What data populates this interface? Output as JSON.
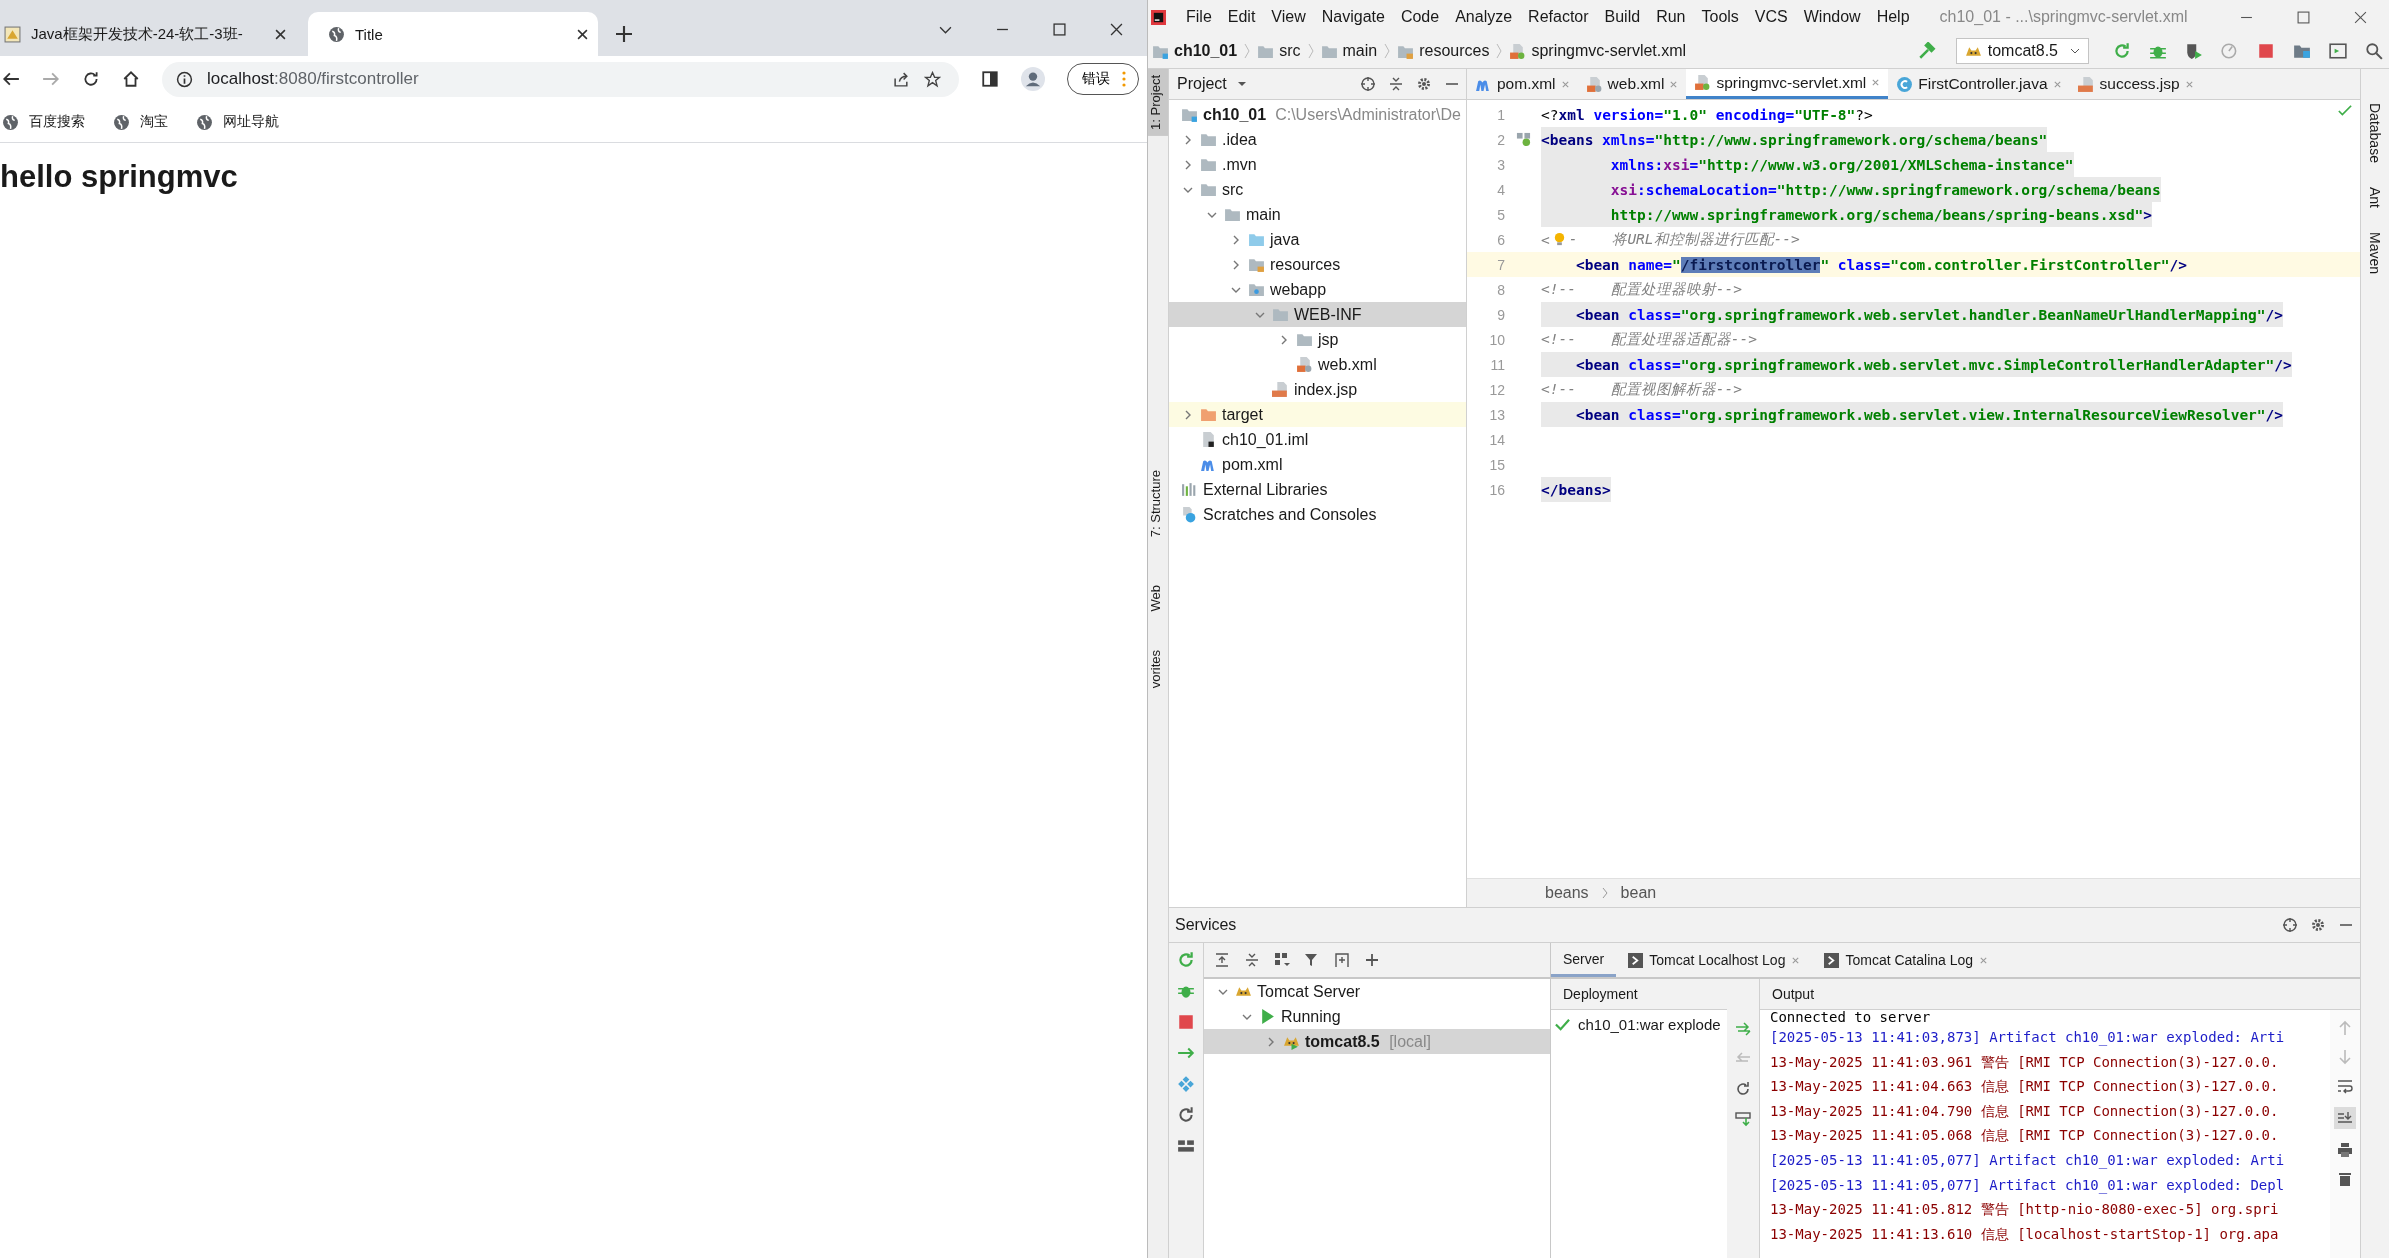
{
  "browser": {
    "tabs": [
      {
        "title": "Java框架开发技术-24-软工-3班-",
        "kind": "site",
        "selected": false
      },
      {
        "title": "Title",
        "kind": "globe",
        "selected": true
      }
    ],
    "address": {
      "host": "localhost",
      "rest": ":8080/firstcontroller"
    },
    "profile_button": "错误",
    "bookmarks": [
      "百度搜索",
      "淘宝",
      "网址导航"
    ],
    "heading": "hello springmvc"
  },
  "ide": {
    "menu": [
      "File",
      "Edit",
      "View",
      "Navigate",
      "Code",
      "Analyze",
      "Refactor",
      "Build",
      "Run",
      "Tools",
      "VCS",
      "Window",
      "Help"
    ],
    "window_title": "ch10_01 - ...\\springmvc-servlet.xml",
    "breadcrumb": [
      {
        "label": "ch10_01",
        "kind": "module"
      },
      {
        "label": "src",
        "kind": "folder"
      },
      {
        "label": "main",
        "kind": "folder"
      },
      {
        "label": "resources",
        "kind": "resources"
      },
      {
        "label": "springmvc-servlet.xml",
        "kind": "spring"
      }
    ],
    "run_config": "tomcat8.5",
    "left_stripe": [
      {
        "label": "1: Project",
        "selected": true
      },
      {
        "label": "7: Structure",
        "selected": false
      },
      {
        "label": "Web",
        "selected": false
      },
      {
        "label": "vorites",
        "selected": false
      }
    ],
    "right_stripe": [
      "Database",
      "Ant",
      "Maven"
    ],
    "project": {
      "title": "Project",
      "root": {
        "name": "ch10_01",
        "path": "C:\\Users\\Administrator\\De",
        "selected": false,
        "children": [
          {
            "name": ".idea",
            "kind": "folder",
            "expanded": false,
            "selected": false
          },
          {
            "name": ".mvn",
            "kind": "folder",
            "expanded": false,
            "selected": false
          },
          {
            "name": "src",
            "kind": "folder",
            "expanded": true,
            "selected": false,
            "children": [
              {
                "name": "main",
                "kind": "folder",
                "expanded": true,
                "selected": false,
                "children": [
                  {
                    "name": "java",
                    "kind": "source",
                    "expanded": false,
                    "selected": false
                  },
                  {
                    "name": "resources",
                    "kind": "resources",
                    "expanded": false,
                    "selected": false
                  },
                  {
                    "name": "webapp",
                    "kind": "web",
                    "expanded": true,
                    "selected": false,
                    "children": [
                      {
                        "name": "WEB-INF",
                        "kind": "folder",
                        "expanded": true,
                        "selected": true,
                        "children": [
                          {
                            "name": "jsp",
                            "kind": "folder",
                            "expanded": false,
                            "selected": false
                          },
                          {
                            "name": "web.xml",
                            "kind": "xml",
                            "selected": false
                          }
                        ]
                      },
                      {
                        "name": "index.jsp",
                        "kind": "jsp",
                        "selected": false
                      }
                    ]
                  }
                ]
              }
            ]
          },
          {
            "name": "target",
            "kind": "excluded",
            "expanded": false,
            "selected": false
          },
          {
            "name": "ch10_01.iml",
            "kind": "iml",
            "selected": false
          },
          {
            "name": "pom.xml",
            "kind": "maven",
            "selected": false
          }
        ]
      },
      "extra": [
        {
          "name": "External Libraries",
          "kind": "libraries",
          "selected": false
        },
        {
          "name": "Scratches and Consoles",
          "kind": "scratches",
          "selected": false
        }
      ]
    },
    "editor_tabs": [
      {
        "label": "pom.xml",
        "kind": "maven",
        "selected": false
      },
      {
        "label": "web.xml",
        "kind": "xml",
        "selected": false
      },
      {
        "label": "springmvc-servlet.xml",
        "kind": "spring",
        "selected": true
      },
      {
        "label": "FirstController.java",
        "kind": "class",
        "selected": false
      },
      {
        "label": "success.jsp",
        "kind": "jsp",
        "selected": false
      }
    ],
    "code_lines": [
      {
        "number": "1",
        "shaded": false,
        "current": false,
        "gutter_icon": false,
        "tokens": [
          {
            "t": "<?",
            "kind": "punct"
          },
          {
            "t": "xml",
            "kind": "tag"
          },
          {
            "t": " version=",
            "kind": "attr"
          },
          {
            "t": "\"1.0\"",
            "kind": "value"
          },
          {
            "t": " encoding=",
            "kind": "attr"
          },
          {
            "t": "\"UTF-8\"",
            "kind": "value"
          },
          {
            "t": "?>",
            "kind": "punct"
          }
        ]
      },
      {
        "number": "2",
        "shaded": true,
        "current": false,
        "gutter_icon": true,
        "tokens": [
          {
            "t": "<beans",
            "kind": "tag"
          },
          {
            "t": " xmlns=",
            "kind": "attr"
          },
          {
            "t": "\"http://www.springframework.org/schema/beans\"",
            "kind": "value"
          }
        ]
      },
      {
        "number": "3",
        "shaded": true,
        "current": false,
        "gutter_icon": false,
        "tokens": [
          {
            "t": "        xmlns:",
            "kind": "attr"
          },
          {
            "t": "xsi",
            "kind": "ns"
          },
          {
            "t": "=",
            "kind": "attr"
          },
          {
            "t": "\"http://www.w3.org/2001/XMLSchema-instance\"",
            "kind": "value"
          }
        ]
      },
      {
        "number": "4",
        "shaded": true,
        "current": false,
        "gutter_icon": false,
        "tokens": [
          {
            "t": "        xsi",
            "kind": "ns"
          },
          {
            "t": ":schemaLocation=",
            "kind": "attr"
          },
          {
            "t": "\"http://www.springframework.org/schema/beans",
            "kind": "value"
          }
        ]
      },
      {
        "number": "5",
        "shaded": true,
        "current": false,
        "gutter_icon": false,
        "tokens": [
          {
            "t": "        http://www.springframework.org/schema/beans/spring-beans.xsd\"",
            "kind": "value"
          },
          {
            "t": ">",
            "kind": "tag"
          }
        ]
      },
      {
        "number": "6",
        "shaded": false,
        "current": false,
        "gutter_icon": false,
        "tokens": [
          {
            "t": "<",
            "kind": "comment"
          },
          {
            "kind": "bulb"
          },
          {
            "t": "-    将URL和控制器进行匹配-->",
            "kind": "comment"
          }
        ]
      },
      {
        "number": "7",
        "shaded": false,
        "current": true,
        "gutter_icon": false,
        "tokens": [
          {
            "t": "    <bean",
            "kind": "tag"
          },
          {
            "t": " name=",
            "kind": "attr"
          },
          {
            "t": "\"",
            "kind": "value"
          },
          {
            "t": "/firstcontroller",
            "kind": "selection"
          },
          {
            "t": "\"",
            "kind": "value"
          },
          {
            "t": " class=",
            "kind": "attr"
          },
          {
            "t": "\"com.controller.FirstController\"",
            "kind": "value"
          },
          {
            "t": "/>",
            "kind": "tag"
          }
        ]
      },
      {
        "number": "8",
        "shaded": false,
        "current": false,
        "gutter_icon": false,
        "tokens": [
          {
            "t": "<!--    配置处理器映射-->",
            "kind": "comment"
          }
        ]
      },
      {
        "number": "9",
        "shaded": true,
        "current": false,
        "gutter_icon": false,
        "tokens": [
          {
            "t": "    <bean",
            "kind": "tag"
          },
          {
            "t": " class=",
            "kind": "attr"
          },
          {
            "t": "\"org.springframework.web.servlet.handler.BeanNameUrlHandlerMapping\"",
            "kind": "value"
          },
          {
            "t": "/>",
            "kind": "tag"
          }
        ]
      },
      {
        "number": "10",
        "shaded": false,
        "current": false,
        "gutter_icon": false,
        "tokens": [
          {
            "t": "<!--    配置处理器适配器-->",
            "kind": "comment"
          }
        ]
      },
      {
        "number": "11",
        "shaded": true,
        "current": false,
        "gutter_icon": false,
        "tokens": [
          {
            "t": "    <bean",
            "kind": "tag"
          },
          {
            "t": " class=",
            "kind": "attr"
          },
          {
            "t": "\"org.springframework.web.servlet.mvc.SimpleControllerHandlerAdapter\"",
            "kind": "value"
          },
          {
            "t": "/>",
            "kind": "tag"
          }
        ]
      },
      {
        "number": "12",
        "shaded": false,
        "current": false,
        "gutter_icon": false,
        "tokens": [
          {
            "t": "<!--    配置视图解析器-->",
            "kind": "comment"
          }
        ]
      },
      {
        "number": "13",
        "shaded": true,
        "current": false,
        "gutter_icon": false,
        "tokens": [
          {
            "t": "    <bean",
            "kind": "tag"
          },
          {
            "t": " class=",
            "kind": "attr"
          },
          {
            "t": "\"org.springframework.web.servlet.view.InternalResourceViewResolver\"",
            "kind": "value"
          },
          {
            "t": "/>",
            "kind": "tag"
          }
        ]
      },
      {
        "number": "14",
        "shaded": false,
        "current": false,
        "gutter_icon": false
      },
      {
        "number": "15",
        "shaded": false,
        "current": false,
        "gutter_icon": false
      },
      {
        "number": "16",
        "shaded": true,
        "current": false,
        "gutter_icon": false,
        "tokens": [
          {
            "t": "</beans>",
            "kind": "tag"
          }
        ]
      }
    ],
    "editor_breadcrumb": [
      "beans",
      "bean"
    ],
    "services": {
      "title": "Services",
      "tree": [
        {
          "name": "Tomcat Server",
          "kind": "tomcat",
          "expanded": true,
          "selected": false,
          "children": [
            {
              "name": "Running",
              "kind": "running",
              "expanded": true,
              "selected": false,
              "children": [
                {
                  "name": "tomcat8.5",
                  "suffix": "[local]",
                  "kind": "tomcat_run",
                  "expanded": false,
                  "selected": true
                }
              ]
            }
          ]
        }
      ],
      "tabs": [
        {
          "label": "Server",
          "closable": false,
          "selected": true
        },
        {
          "label": "Tomcat Localhost Log",
          "closable": true,
          "selected": false
        },
        {
          "label": "Tomcat Catalina Log",
          "closable": true,
          "selected": false
        }
      ],
      "deployment_header": "Deployment",
      "deployments": [
        "ch10_01:war explode"
      ],
      "output_header": "Output",
      "output": [
        {
          "kind": "plain",
          "text": "Connected to server"
        },
        {
          "kind": "artifact",
          "text": "[2025-05-13 11:41:03,873] Artifact ch10_01:war exploded: Arti"
        },
        {
          "kind": "log",
          "text": "13-May-2025 11:41:03.961 警告 [RMI TCP Connection(3)-127.0.0."
        },
        {
          "kind": "log",
          "text": "13-May-2025 11:41:04.663 信息 [RMI TCP Connection(3)-127.0.0."
        },
        {
          "kind": "log",
          "text": "13-May-2025 11:41:04.790 信息 [RMI TCP Connection(3)-127.0.0."
        },
        {
          "kind": "log",
          "text": "13-May-2025 11:41:05.068 信息 [RMI TCP Connection(3)-127.0.0."
        },
        {
          "kind": "artifact",
          "text": "[2025-05-13 11:41:05,077] Artifact ch10_01:war exploded: Arti"
        },
        {
          "kind": "artifact",
          "text": "[2025-05-13 11:41:05,077] Artifact ch10_01:war exploded: Depl"
        },
        {
          "kind": "log",
          "text": "13-May-2025 11:41:05.812 警告 [http-nio-8080-exec-5] org.spri"
        },
        {
          "kind": "log",
          "text": "13-May-2025 11:41:13.610 信息 [localhost-startStop-1] org.apa"
        }
      ]
    }
  }
}
